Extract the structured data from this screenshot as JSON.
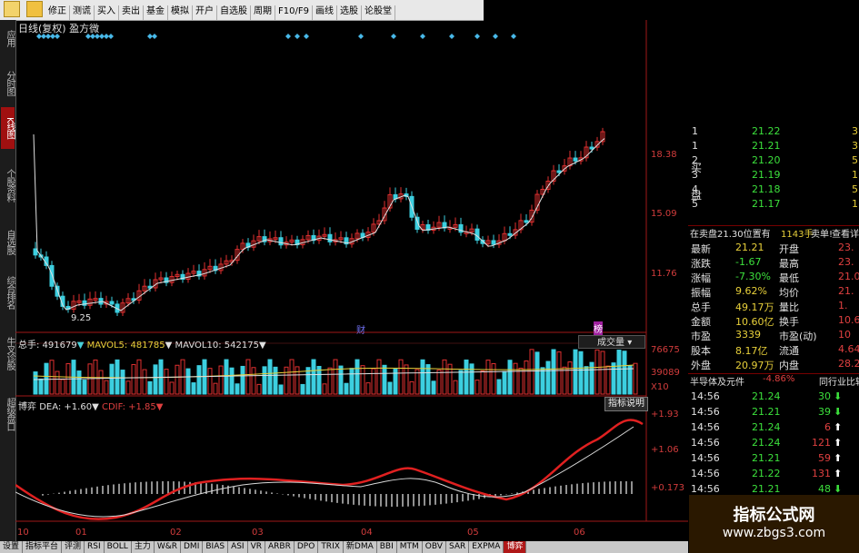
{
  "toolbar": {
    "items": [
      "修正",
      "测谎",
      "买入",
      "卖出",
      "基金",
      "模拟",
      "开户",
      "自选股",
      "周期",
      "F10/F9",
      "画线",
      "选股",
      "论股堂"
    ]
  },
  "left_nav": [
    {
      "label": "应用",
      "active": false
    },
    {
      "label": "分时图",
      "active": false
    },
    {
      "label": "K线图",
      "active": true
    },
    {
      "label": "个股资料",
      "active": false
    },
    {
      "label": "自选股",
      "active": false
    },
    {
      "label": "综合排名",
      "active": false
    },
    {
      "label": "牛叉诊股",
      "active": false
    },
    {
      "label": "超级盘口",
      "active": false
    }
  ],
  "main_chart": {
    "title": "日线(复权)",
    "stock_name": "盈方微",
    "y_labels": [
      "18.38",
      "15.09",
      "11.76"
    ],
    "low_label": "9.25",
    "markers": [
      "财",
      "榜"
    ],
    "colors": {
      "up": "#e03030",
      "down": "#3ccfe0",
      "ma": "#e0e0e0"
    }
  },
  "volume": {
    "label_total": "总手: 491679",
    "mavol5": "MAVOL5: 481785",
    "mavol10": "MAVOL10: 542175",
    "button": "成交量",
    "y_labels": [
      "76675",
      "39089",
      "X10"
    ]
  },
  "macd": {
    "title": "博弈",
    "dea": "DEA: +1.60",
    "cdif": "CDIF: +1.85",
    "button": "指标说明",
    "y_labels": [
      "+1.93",
      "+1.06",
      "+0.173"
    ]
  },
  "x_axis": [
    "10",
    "01",
    "02",
    "03",
    "04",
    "05",
    "06"
  ],
  "orderbook": {
    "side_sell": "买",
    "side_buy": "盘",
    "rows": [
      {
        "level": "1",
        "price": "21.22",
        "vol": "3"
      },
      {
        "level": "1",
        "price": "21.21",
        "vol": "3"
      },
      {
        "level": "2",
        "price": "21.20",
        "vol": "5"
      },
      {
        "level": "3",
        "price": "21.19",
        "vol": "1"
      },
      {
        "level": "4",
        "price": "21.18",
        "vol": "5"
      },
      {
        "level": "5",
        "price": "21.17",
        "vol": "1"
      }
    ],
    "notice": "在卖盘21.30位置有",
    "notice_vol": "1143手",
    "notice_action": "卖单!",
    "notice_link": "查看详"
  },
  "quote": {
    "rows": [
      {
        "l1": "最新",
        "v1": "21.21",
        "l2": "开盘",
        "v2": "23."
      },
      {
        "l1": "涨跌",
        "v1": "-1.67",
        "l2": "最高",
        "v2": "23."
      },
      {
        "l1": "涨幅",
        "v1": "-7.30%",
        "l2": "最低",
        "v2": "21.0"
      },
      {
        "l1": "振幅",
        "v1": "9.62%",
        "l2": "均价",
        "v2": "21."
      },
      {
        "l1": "总手",
        "v1": "49.17万",
        "l2": "量比",
        "v2": "1."
      },
      {
        "l1": "金额",
        "v1": "10.60亿",
        "l2": "换手",
        "v2": "10.60"
      },
      {
        "l1": "市盈",
        "v1": "3339",
        "l2": "市盈(动)",
        "v2": "10"
      },
      {
        "l1": "股本",
        "v1": "8.17亿",
        "l2": "流通",
        "v2": "4.64"
      },
      {
        "l1": "外盘",
        "v1": "20.97万",
        "l2": "内盘",
        "v2": "28.20"
      }
    ],
    "sector": "半导体及元件",
    "sector_change": "-4.86%",
    "sector_link": "同行业比较"
  },
  "ticks": [
    {
      "time": "14:56",
      "price": "21.24",
      "vol": "30",
      "dir": "down"
    },
    {
      "time": "14:56",
      "price": "21.21",
      "vol": "39",
      "dir": "down"
    },
    {
      "time": "14:56",
      "price": "21.24",
      "vol": "6",
      "dir": "up"
    },
    {
      "time": "14:56",
      "price": "21.24",
      "vol": "121",
      "dir": "up"
    },
    {
      "time": "14:56",
      "price": "21.21",
      "vol": "59",
      "dir": "up"
    },
    {
      "time": "14:56",
      "price": "21.22",
      "vol": "131",
      "dir": "up"
    },
    {
      "time": "14:56",
      "price": "21.21",
      "vol": "48",
      "dir": "down"
    }
  ],
  "watermark": {
    "title": "指标公式网",
    "url": "www.zbgs3.com"
  },
  "bottom_tabs": [
    "设置",
    "指标平台",
    "评测",
    "RSI",
    "BOLL",
    "主力",
    "W&R",
    "DMI",
    "BIAS",
    "ASI",
    "VR",
    "ARBR",
    "DPO",
    "TRIX",
    "新DMA",
    "BBI",
    "MTM",
    "OBV",
    "SAR",
    "EXPMA",
    "博弈"
  ],
  "active_tab": "博弈"
}
